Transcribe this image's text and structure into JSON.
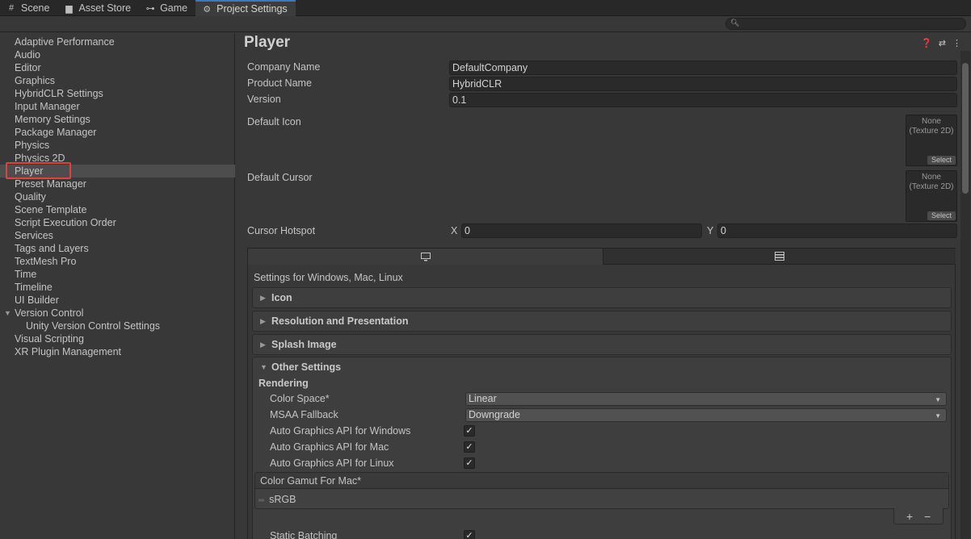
{
  "tabs": [
    {
      "label": "Scene",
      "icon": "grid-icon"
    },
    {
      "label": "Asset Store",
      "icon": "store-icon"
    },
    {
      "label": "Game",
      "icon": "gamepad-icon"
    },
    {
      "label": "Project Settings",
      "icon": "gear-icon",
      "active": true
    }
  ],
  "search": {
    "placeholder": ""
  },
  "sidebar": {
    "items": [
      "Adaptive Performance",
      "Audio",
      "Editor",
      "Graphics",
      "HybridCLR Settings",
      "Input Manager",
      "Memory Settings",
      "Package Manager",
      "Physics",
      "Physics 2D",
      "Player",
      "Preset Manager",
      "Quality",
      "Scene Template",
      "Script Execution Order",
      "Services",
      "Tags and Layers",
      "TextMesh Pro",
      "Time",
      "Timeline",
      "UI Builder",
      "Version Control",
      "Unity Version Control Settings",
      "Visual Scripting",
      "XR Plugin Management"
    ],
    "selected": "Player"
  },
  "player": {
    "title": "Player",
    "company_label": "Company Name",
    "company_value": "DefaultCompany",
    "product_label": "Product Name",
    "product_value": "HybridCLR",
    "version_label": "Version",
    "version_value": "0.1",
    "default_icon_label": "Default Icon",
    "default_cursor_label": "Default Cursor",
    "texture_none_line1": "None",
    "texture_none_line2": "(Texture 2D)",
    "select_label": "Select",
    "cursor_hotspot_label": "Cursor Hotspot",
    "x_label": "X",
    "x_value": "0",
    "y_label": "Y",
    "y_value": "0"
  },
  "platform": {
    "caption": "Settings for Windows, Mac, Linux",
    "sections": [
      "Icon",
      "Resolution and Presentation",
      "Splash Image",
      "Other Settings"
    ],
    "rendering_label": "Rendering",
    "color_space_label": "Color Space*",
    "color_space_value": "Linear",
    "msaa_label": "MSAA Fallback",
    "msaa_value": "Downgrade",
    "auto_win_label": "Auto Graphics API  for Windows",
    "auto_mac_label": "Auto Graphics API  for Mac",
    "auto_linux_label": "Auto Graphics API  for Linux",
    "gamut_label": "Color Gamut For Mac*",
    "gamut_item": "sRGB",
    "static_batching_label": "Static Batching"
  }
}
